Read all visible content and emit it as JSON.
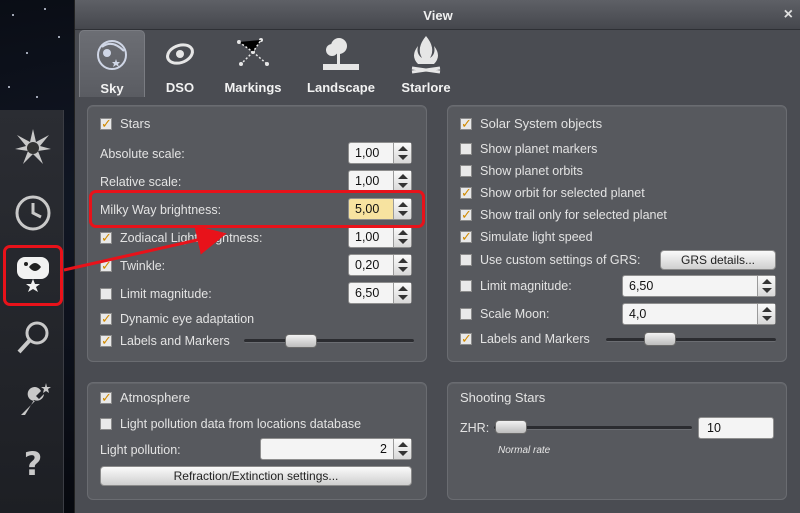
{
  "dialog": {
    "title": "View",
    "close_glyph": "×"
  },
  "tabs": [
    {
      "label": "Sky",
      "icon": "sky-icon",
      "active": true
    },
    {
      "label": "DSO",
      "icon": "galaxy-icon"
    },
    {
      "label": "Markings",
      "icon": "constellation-icon"
    },
    {
      "label": "Landscape",
      "icon": "landscape-icon"
    },
    {
      "label": "Starlore",
      "icon": "campfire-icon"
    }
  ],
  "sidebar": [
    {
      "name": "location-icon"
    },
    {
      "name": "clock-icon"
    },
    {
      "name": "sky-view-icon",
      "highlighted": true
    },
    {
      "name": "search-icon"
    },
    {
      "name": "configuration-icon"
    },
    {
      "name": "help-icon"
    }
  ],
  "stars": {
    "heading": "Stars",
    "checked": true,
    "absolute_scale_label": "Absolute scale:",
    "absolute_scale": "1,00",
    "relative_scale_label": "Relative scale:",
    "relative_scale": "1,00",
    "milky_way_label": "Milky Way brightness:",
    "milky_way": "5,00",
    "zodiacal_label": "Zodiacal Light brightness:",
    "zodiacal": "1,00",
    "zodiacal_checked": true,
    "twinkle_label": "Twinkle:",
    "twinkle": "0,20",
    "twinkle_checked": true,
    "limit_label": "Limit magnitude:",
    "limit": "6,50",
    "limit_checked": false,
    "dynamic_eye_label": "Dynamic eye adaptation",
    "dynamic_eye_checked": true,
    "labels_label": "Labels and Markers",
    "labels_checked": true
  },
  "solar": {
    "heading": "Solar System objects",
    "checked": true,
    "items": [
      {
        "label": "Show planet markers",
        "checked": false
      },
      {
        "label": "Show planet orbits",
        "checked": false
      },
      {
        "label": "Show orbit for selected planet",
        "checked": true
      },
      {
        "label": "Show trail only for selected planet",
        "checked": true
      },
      {
        "label": "Simulate light speed",
        "checked": true
      }
    ],
    "grs_label": "Use custom settings of GRS:",
    "grs_checked": false,
    "grs_button": "GRS details...",
    "limit_label": "Limit magnitude:",
    "limit": "6,50",
    "limit_checked": false,
    "scale_moon_label": "Scale Moon:",
    "scale_moon": "4,0",
    "scale_moon_checked": false,
    "labels_label": "Labels and Markers",
    "labels_checked": true
  },
  "atmosphere": {
    "heading": "Atmosphere",
    "checked": true,
    "pollution_db_label": "Light pollution data from locations database",
    "pollution_db_checked": false,
    "light_pollution_label": "Light pollution:",
    "light_pollution": "2",
    "refraction_button": "Refraction/Extinction settings..."
  },
  "shooting": {
    "heading": "Shooting Stars",
    "zhr_label": "ZHR:",
    "zhr": "10",
    "rate_note": "Normal rate"
  },
  "colors": {
    "annotation": "#e8121a",
    "check": "#d08a00"
  }
}
